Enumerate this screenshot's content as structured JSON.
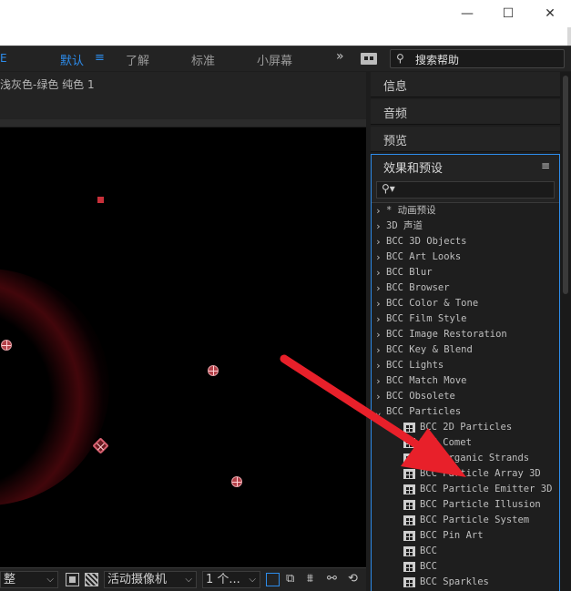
{
  "window": {
    "minimize": "—",
    "maximize": "☐",
    "close": "✕"
  },
  "workspace": {
    "edge_glyph": "E",
    "items": [
      "默认",
      "了解",
      "标准",
      "小屏幕"
    ],
    "menu_glyph": "≡",
    "more_glyph": "»",
    "search_help": "搜索帮助",
    "search_icon": "⚲"
  },
  "composition": {
    "title": "浅灰色-绿色 纯色 1"
  },
  "viewer_bar": {
    "zoom": "整",
    "camera": "活动摄像机",
    "views": "1 个..."
  },
  "panels": [
    "信息",
    "音频",
    "预览"
  ],
  "effects": {
    "title": "效果和预设",
    "menu": "≡",
    "search_icon": "⚲▾",
    "categories": [
      "* 动画预设",
      "3D 声道",
      "BCC 3D Objects",
      "BCC Art Looks",
      "BCC Blur",
      "BCC Browser",
      "BCC Color & Tone",
      "BCC Film Style",
      "BCC Image Restoration",
      "BCC Key & Blend",
      "BCC Lights",
      "BCC Match Move",
      "BCC Obsolete",
      "BCC Particles"
    ],
    "particles": [
      "BCC 2D Particles",
      "BCC Comet",
      "BCC Organic Strands",
      "BCC Particle Array 3D",
      "BCC Particle Emitter 3D",
      "BCC Particle Illusion",
      "BCC Particle System",
      "BCC Pin Art",
      "BCC",
      "BCC",
      "BCC Sparkles"
    ]
  },
  "colors": {
    "accent": "#2d8ceb",
    "arrow": "#e8202a"
  }
}
